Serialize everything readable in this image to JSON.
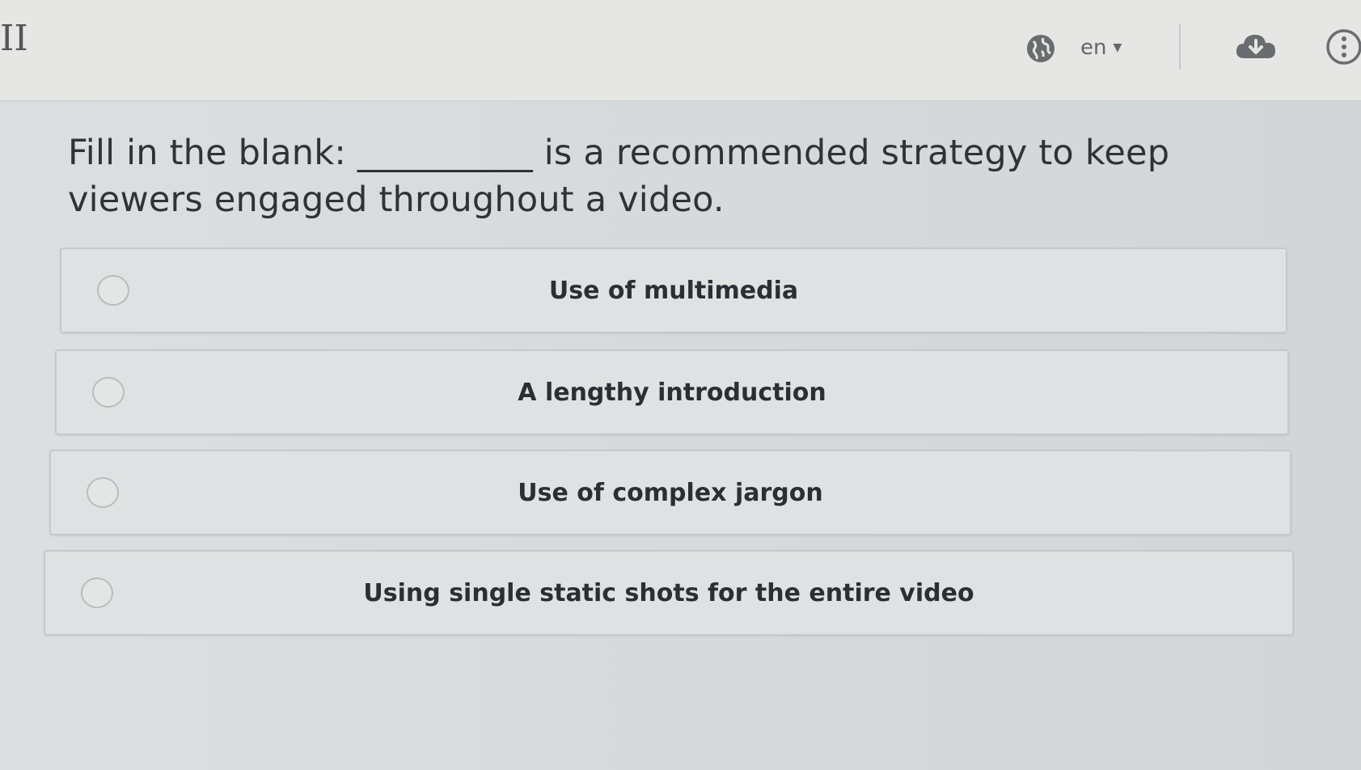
{
  "header": {
    "logo_fragment": "II",
    "language": "en"
  },
  "question": {
    "text": "Fill in the blank: __________ is a recommended strategy to keep viewers engaged throughout a video."
  },
  "options": [
    {
      "label": "Use of multimedia",
      "selected": false
    },
    {
      "label": "A lengthy introduction",
      "selected": false
    },
    {
      "label": "Use of complex jargon",
      "selected": false
    },
    {
      "label": "Using single static shots for the entire video",
      "selected": false
    }
  ],
  "icons": {
    "globe": "globe-icon",
    "caret": "chevron-down-icon",
    "download": "cloud-download-icon",
    "more": "more-vertical-icon"
  },
  "colors": {
    "icon": "#6a6d70",
    "text": "#2f3338",
    "option_bg": "#dfe2e2",
    "option_border": "#c3cacc"
  }
}
